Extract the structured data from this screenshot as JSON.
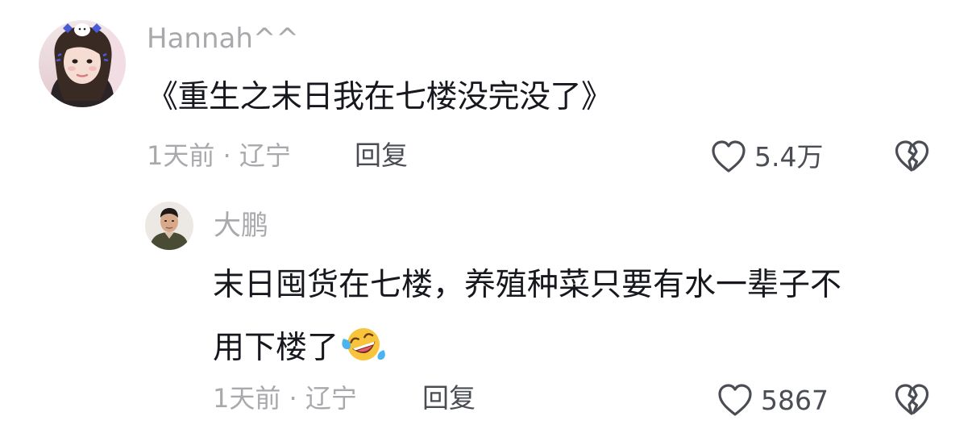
{
  "comments": [
    {
      "username": "Hannah^^",
      "text": "《重生之末日我在七楼没完没了》",
      "meta": "1天前 · 辽宁",
      "reply_label": "回复",
      "like_count": "5.4万",
      "avatar_icon": "user-avatar-photo"
    }
  ],
  "replies": [
    {
      "username": "大鹏",
      "text_line1": "末日囤货在七楼，养殖种菜只要有水一辈子不",
      "text_line2": "用下楼了",
      "emoji": "laughing-tears-emoji",
      "meta": "1天前 · 辽宁",
      "reply_label": "回复",
      "like_count": "5867",
      "avatar_icon": "user-avatar-photo"
    }
  ],
  "icons": {
    "like": "heart-icon",
    "dislike": "broken-heart-icon"
  },
  "colors": {
    "text": "#16181d",
    "secondary": "#a9a9ad",
    "action": "#4b4d54",
    "background": "#ffffff"
  }
}
